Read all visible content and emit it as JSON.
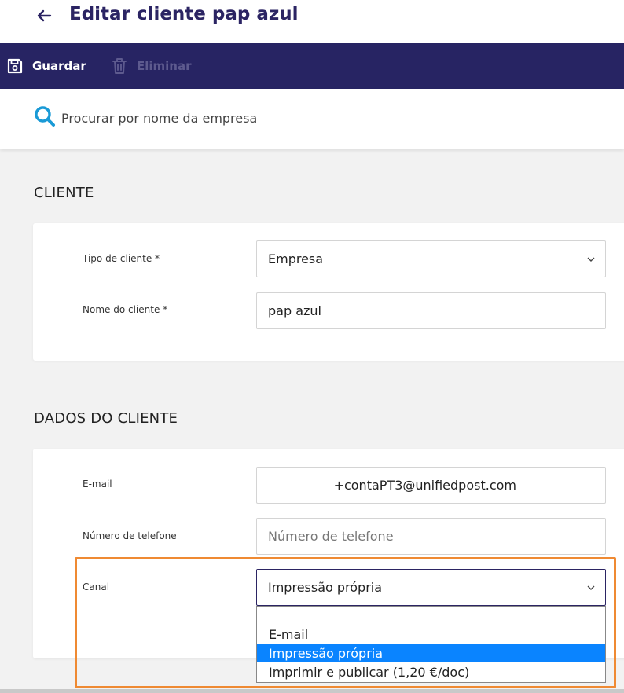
{
  "header": {
    "title": "Editar cliente pap azul",
    "back_icon": "arrow-left-icon"
  },
  "toolbar": {
    "save_label": "Guardar",
    "delete_label": "Eliminar",
    "save_icon": "floppy-disk-icon",
    "delete_icon": "trash-icon",
    "color": "#272463"
  },
  "search": {
    "placeholder": "Procurar por nome da empresa",
    "icon": "search-icon",
    "icon_color": "#1a9ad6"
  },
  "client_section": {
    "title": "CLIENTE",
    "tipo_label": "Tipo de cliente *",
    "tipo_value": "Empresa",
    "nome_label": "Nome do cliente *",
    "nome_value": "pap azul"
  },
  "dados_section": {
    "title": "DADOS DO CLIENTE",
    "email_label": "E-mail",
    "email_value": "+contaPT3@unifiedpost.com",
    "phone_label": "Número de telefone",
    "phone_placeholder": "Número de telefone",
    "canal_label": "Canal",
    "canal_value": "Impressão própria",
    "canal_options": [
      "E-mail",
      "Impressão própria",
      "Imprimir e publicar (1,20 €/doc)"
    ],
    "canal_selected_index": 1
  },
  "colors": {
    "title": "#2b2463",
    "highlight_border": "#ef8a33",
    "selected_option": "#0a84ff"
  }
}
